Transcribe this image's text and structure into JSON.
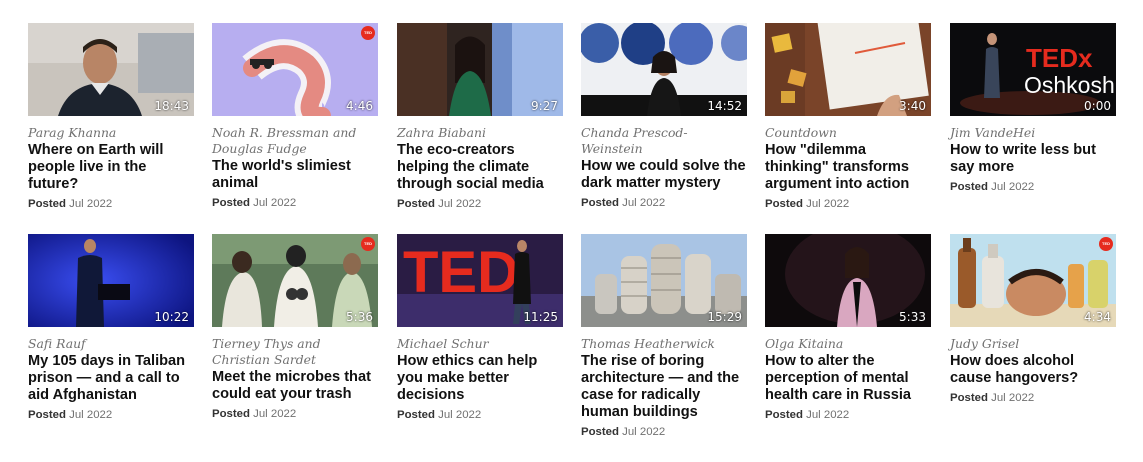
{
  "talks": [
    {
      "speaker": "Parag Khanna",
      "title": "Where on Earth will people live in the future?",
      "duration": "18:43",
      "posted_label": "Posted",
      "posted_date": "Jul 2022"
    },
    {
      "speaker": "Noah R. Bressman and Douglas Fudge",
      "title": "The world's slimiest animal",
      "duration": "4:46",
      "posted_label": "Posted",
      "posted_date": "Jul 2022"
    },
    {
      "speaker": "Zahra Biabani",
      "title": "The eco-creators helping the climate through social media",
      "duration": "9:27",
      "posted_label": "Posted",
      "posted_date": "Jul 2022"
    },
    {
      "speaker": "Chanda Prescod-Weinstein",
      "title": "How we could solve the dark matter mystery",
      "duration": "14:52",
      "posted_label": "Posted",
      "posted_date": "Jul 2022"
    },
    {
      "speaker": "Countdown",
      "title": "How \"dilemma thinking\" transforms argument into action",
      "duration": "3:40",
      "posted_label": "Posted",
      "posted_date": "Jul 2022"
    },
    {
      "speaker": "Jim VandeHei",
      "title": "How to write less but say more",
      "duration": "0:00",
      "posted_label": "Posted",
      "posted_date": "Jul 2022",
      "logo_text": "TEDx",
      "logo_sub": "Oshkosh"
    },
    {
      "speaker": "Safi Rauf",
      "title": "My 105 days in Taliban prison — and a call to aid Afghanistan",
      "duration": "10:22",
      "posted_label": "Posted",
      "posted_date": "Jul 2022"
    },
    {
      "speaker": "Tierney Thys and Christian Sardet",
      "title": "Meet the microbes that could eat your trash",
      "duration": "5:36",
      "posted_label": "Posted",
      "posted_date": "Jul 2022"
    },
    {
      "speaker": "Michael Schur",
      "title": "How ethics can help you make better decisions",
      "duration": "11:25",
      "posted_label": "Posted",
      "posted_date": "Jul 2022",
      "logo_text": "TED"
    },
    {
      "speaker": "Thomas Heatherwick",
      "title": "The rise of boring architecture — and the case for radically human buildings",
      "duration": "15:29",
      "posted_label": "Posted",
      "posted_date": "Jul 2022"
    },
    {
      "speaker": "Olga Kitaina",
      "title": "How to alter the perception of mental health care in Russia",
      "duration": "5:33",
      "posted_label": "Posted",
      "posted_date": "Jul 2022"
    },
    {
      "speaker": "Judy Grisel",
      "title": "How does alcohol cause hangovers?",
      "duration": "4:34",
      "posted_label": "Posted",
      "posted_date": "Jul 2022"
    }
  ],
  "colors": {
    "ted_red": "#e62b1e",
    "title_text": "#111111",
    "meta_text": "#707070"
  }
}
